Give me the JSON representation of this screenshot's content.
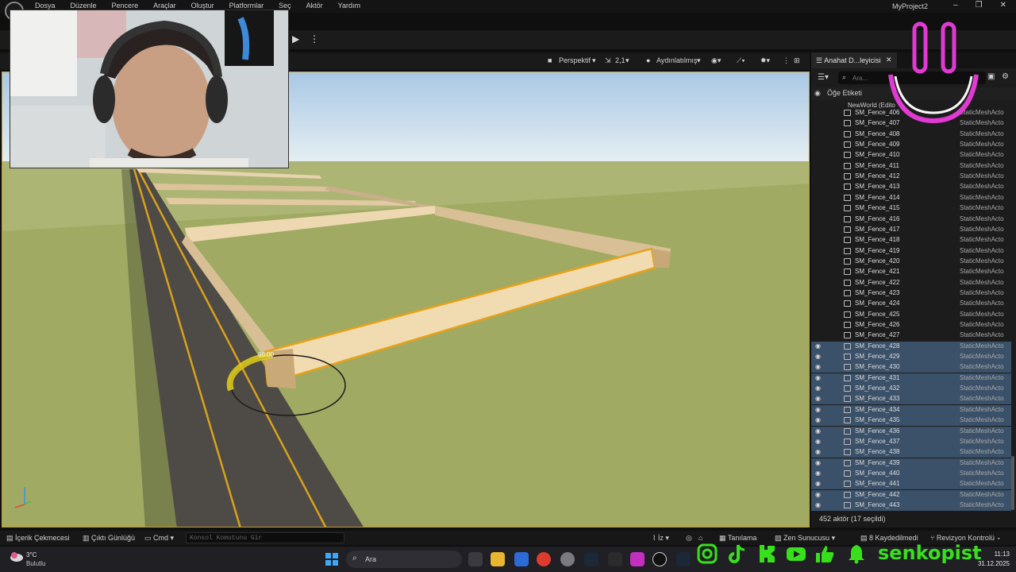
{
  "menubar": {
    "items": [
      "Dosya",
      "Düzenle",
      "Pencere",
      "Araçlar",
      "Oluştur",
      "Platformlar",
      "Seç",
      "Aktör",
      "Yardım"
    ],
    "project": "MyProject2"
  },
  "viewport": {
    "perspective_label": "Perspektif",
    "fov_label": "2,1",
    "lighting_label": "Aydınlatılmış",
    "angle_readout": "90.00"
  },
  "outliner": {
    "tab_label": "Anahat D...leyicisi",
    "search_placeholder": "Ara...",
    "column_label": "Öğe Etiketi",
    "world_label": "NewWorld (Edito",
    "rows": [
      {
        "name": "SM_Fence_406",
        "type": "StaticMeshActo",
        "selected": false
      },
      {
        "name": "SM_Fence_407",
        "type": "StaticMeshActo",
        "selected": false
      },
      {
        "name": "SM_Fence_408",
        "type": "StaticMeshActo",
        "selected": false
      },
      {
        "name": "SM_Fence_409",
        "type": "StaticMeshActo",
        "selected": false
      },
      {
        "name": "SM_Fence_410",
        "type": "StaticMeshActo",
        "selected": false
      },
      {
        "name": "SM_Fence_411",
        "type": "StaticMeshActo",
        "selected": false
      },
      {
        "name": "SM_Fence_412",
        "type": "StaticMeshActo",
        "selected": false
      },
      {
        "name": "SM_Fence_413",
        "type": "StaticMeshActo",
        "selected": false
      },
      {
        "name": "SM_Fence_414",
        "type": "StaticMeshActo",
        "selected": false
      },
      {
        "name": "SM_Fence_415",
        "type": "StaticMeshActo",
        "selected": false
      },
      {
        "name": "SM_Fence_416",
        "type": "StaticMeshActo",
        "selected": false
      },
      {
        "name": "SM_Fence_417",
        "type": "StaticMeshActo",
        "selected": false
      },
      {
        "name": "SM_Fence_418",
        "type": "StaticMeshActo",
        "selected": false
      },
      {
        "name": "SM_Fence_419",
        "type": "StaticMeshActo",
        "selected": false
      },
      {
        "name": "SM_Fence_420",
        "type": "StaticMeshActo",
        "selected": false
      },
      {
        "name": "SM_Fence_421",
        "type": "StaticMeshActo",
        "selected": false
      },
      {
        "name": "SM_Fence_422",
        "type": "StaticMeshActo",
        "selected": false
      },
      {
        "name": "SM_Fence_423",
        "type": "StaticMeshActo",
        "selected": false
      },
      {
        "name": "SM_Fence_424",
        "type": "StaticMeshActo",
        "selected": false
      },
      {
        "name": "SM_Fence_425",
        "type": "StaticMeshActo",
        "selected": false
      },
      {
        "name": "SM_Fence_426",
        "type": "StaticMeshActo",
        "selected": false
      },
      {
        "name": "SM_Fence_427",
        "type": "StaticMeshActo",
        "selected": false
      },
      {
        "name": "SM_Fence_428",
        "type": "StaticMeshActo",
        "selected": true
      },
      {
        "name": "SM_Fence_429",
        "type": "StaticMeshActo",
        "selected": true
      },
      {
        "name": "SM_Fence_430",
        "type": "StaticMeshActo",
        "selected": true
      },
      {
        "name": "SM_Fence_431",
        "type": "StaticMeshActo",
        "selected": true
      },
      {
        "name": "SM_Fence_432",
        "type": "StaticMeshActo",
        "selected": true
      },
      {
        "name": "SM_Fence_433",
        "type": "StaticMeshActo",
        "selected": true
      },
      {
        "name": "SM_Fence_434",
        "type": "StaticMeshActo",
        "selected": true
      },
      {
        "name": "SM_Fence_435",
        "type": "StaticMeshActo",
        "selected": true
      },
      {
        "name": "SM_Fence_436",
        "type": "StaticMeshActo",
        "selected": true
      },
      {
        "name": "SM_Fence_437",
        "type": "StaticMeshActo",
        "selected": true
      },
      {
        "name": "SM_Fence_438",
        "type": "StaticMeshActo",
        "selected": true
      },
      {
        "name": "SM_Fence_439",
        "type": "StaticMeshActo",
        "selected": true
      },
      {
        "name": "SM_Fence_440",
        "type": "StaticMeshActo",
        "selected": true
      },
      {
        "name": "SM_Fence_441",
        "type": "StaticMeshActo",
        "selected": true
      },
      {
        "name": "SM_Fence_442",
        "type": "StaticMeshActo",
        "selected": true
      },
      {
        "name": "SM_Fence_443",
        "type": "StaticMeshActo",
        "selected": true
      }
    ],
    "footer": "452 aktör (17 seçildi)"
  },
  "statusbar": {
    "content_drawer": "İçerik Çekmecesi",
    "output_log": "Çıktı Günlüğü",
    "cmd": "Cmd",
    "console_placeholder": "Konsol Komutunu Gir",
    "trace": "İz",
    "derived": "Tanılama",
    "zen": "Zen Sunucusu",
    "saved": "8 Kaydedilmedi",
    "revision": "Revizyon Kontrolü"
  },
  "taskbar": {
    "temp": "3°C",
    "condition": "Bulutlu",
    "search_label": "Ara",
    "time": "11:13",
    "date": "31.12.2025"
  },
  "social": {
    "handle": "senkopist"
  },
  "colors": {
    "selection": "#3b5169",
    "accent_green": "#38e01c",
    "smile_pink": "#e03ad2",
    "fence_orange": "#e6a21a"
  }
}
